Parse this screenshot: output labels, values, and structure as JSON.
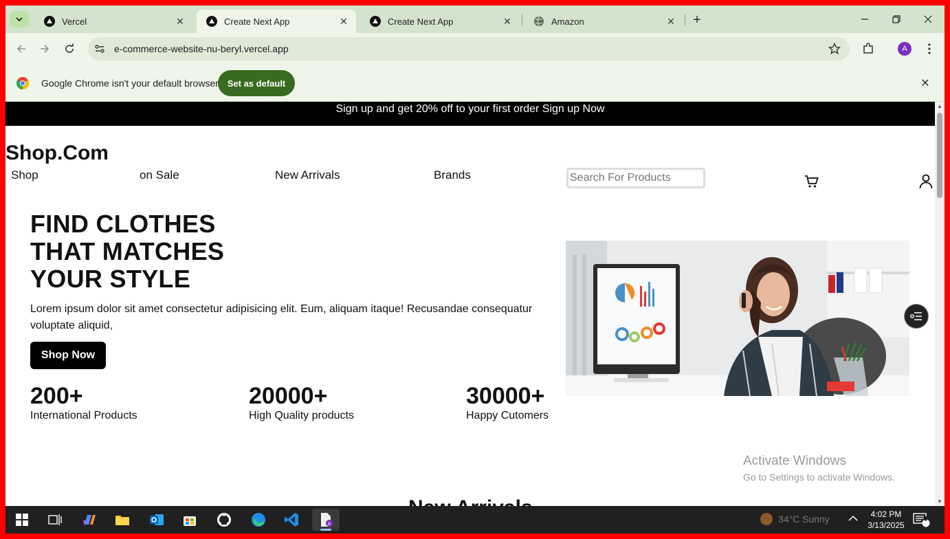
{
  "browser": {
    "tabs": [
      {
        "label": "Vercel",
        "active": false,
        "favicon": "vercel-icon"
      },
      {
        "label": "Create Next App",
        "active": true,
        "favicon": "vercel-icon"
      },
      {
        "label": "Create Next App",
        "active": false,
        "favicon": "vercel-icon"
      },
      {
        "label": "Amazon",
        "active": false,
        "favicon": "globe-icon"
      }
    ],
    "url": "e-commerce-website-nu-beryl.vercel.app",
    "profile_initial": "A",
    "infobar": {
      "message": "Google Chrome isn't your default browser",
      "button": "Set as default"
    }
  },
  "page": {
    "promo": "Sign up and get 20% off to your first order Sign up Now",
    "logo": "Shop.Com",
    "nav": [
      "Shop",
      "on Sale",
      "New Arrivals",
      "Brands"
    ],
    "search_placeholder": "Search For Products",
    "hero": {
      "title_line1": "FIND CLOTHES",
      "title_line2": "THAT MATCHES",
      "title_line3": "YOUR STYLE",
      "description": "Lorem ipsum dolor sit amet consectetur adipisicing elit. Eum, aliquam itaque! Recusandae consequatur voluptate aliquid,",
      "cta": "Shop Now"
    },
    "stats": [
      {
        "value": "200+",
        "label": "International Products"
      },
      {
        "value": "20000+",
        "label": "High Quality products"
      },
      {
        "value": "30000+",
        "label": "Happy Cutomers"
      }
    ],
    "section_heading": "New Arrivals"
  },
  "watermark": {
    "line1": "Activate Windows",
    "line2": "Go to Settings to activate Windows."
  },
  "taskbar": {
    "weather": "34°C  Sunny",
    "time": "4:02 PM",
    "date": "3/13/2025",
    "notification_count": "4"
  },
  "colors": {
    "tabstrip": "#d3e3cd",
    "toolbar": "#f0f5ea",
    "set_default_button": "#386a20",
    "promo_bar": "#000000",
    "taskbar": "#202020"
  }
}
